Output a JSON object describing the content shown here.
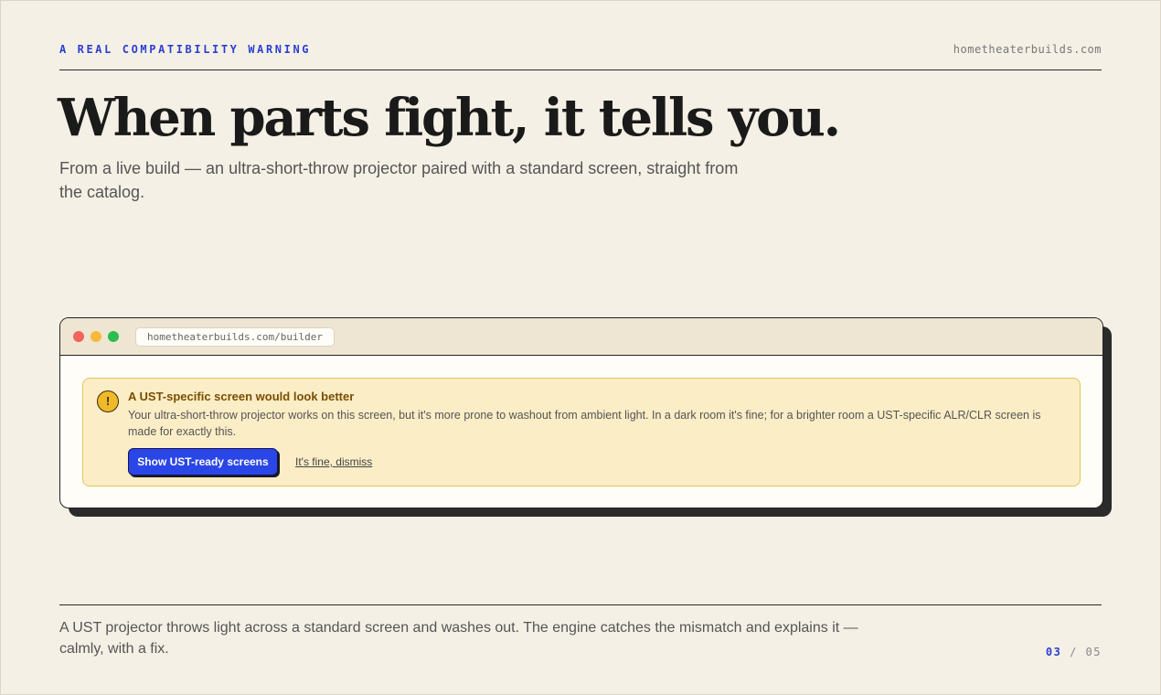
{
  "header": {
    "kicker": "A REAL COMPATIBILITY WARNING",
    "domain": "hometheaterbuilds.com"
  },
  "hero": {
    "headline": "When parts fight, it tells you.",
    "subhead": "From a live build — an ultra-short-throw projector paired with a standard screen, straight from the catalog."
  },
  "browser": {
    "url": "hometheaterbuilds.com/builder",
    "alert": {
      "icon": "warning-icon",
      "icon_glyph": "!",
      "title": "A UST-specific screen would look better",
      "body": "Your ultra-short-throw projector works on this screen, but it's more prone to washout from ambient light. In a dark room it's fine; for a brighter room a UST-specific ALR/CLR screen is made for exactly this.",
      "primary_label": "Show UST-ready screens",
      "dismiss_label": "It's fine, dismiss"
    }
  },
  "footer": {
    "caption": "A UST projector throws light across a standard screen and washes out. The engine catches the mismatch and explains it — calmly, with a fix.",
    "page_current": "03",
    "page_sep": " / ",
    "page_total": "05"
  },
  "colors": {
    "background": "#f5f0e5",
    "accent": "#2b3fd1",
    "warning_bg": "#fbedc6",
    "warning_icon": "#f0b92a",
    "button": "#2b46e6"
  }
}
